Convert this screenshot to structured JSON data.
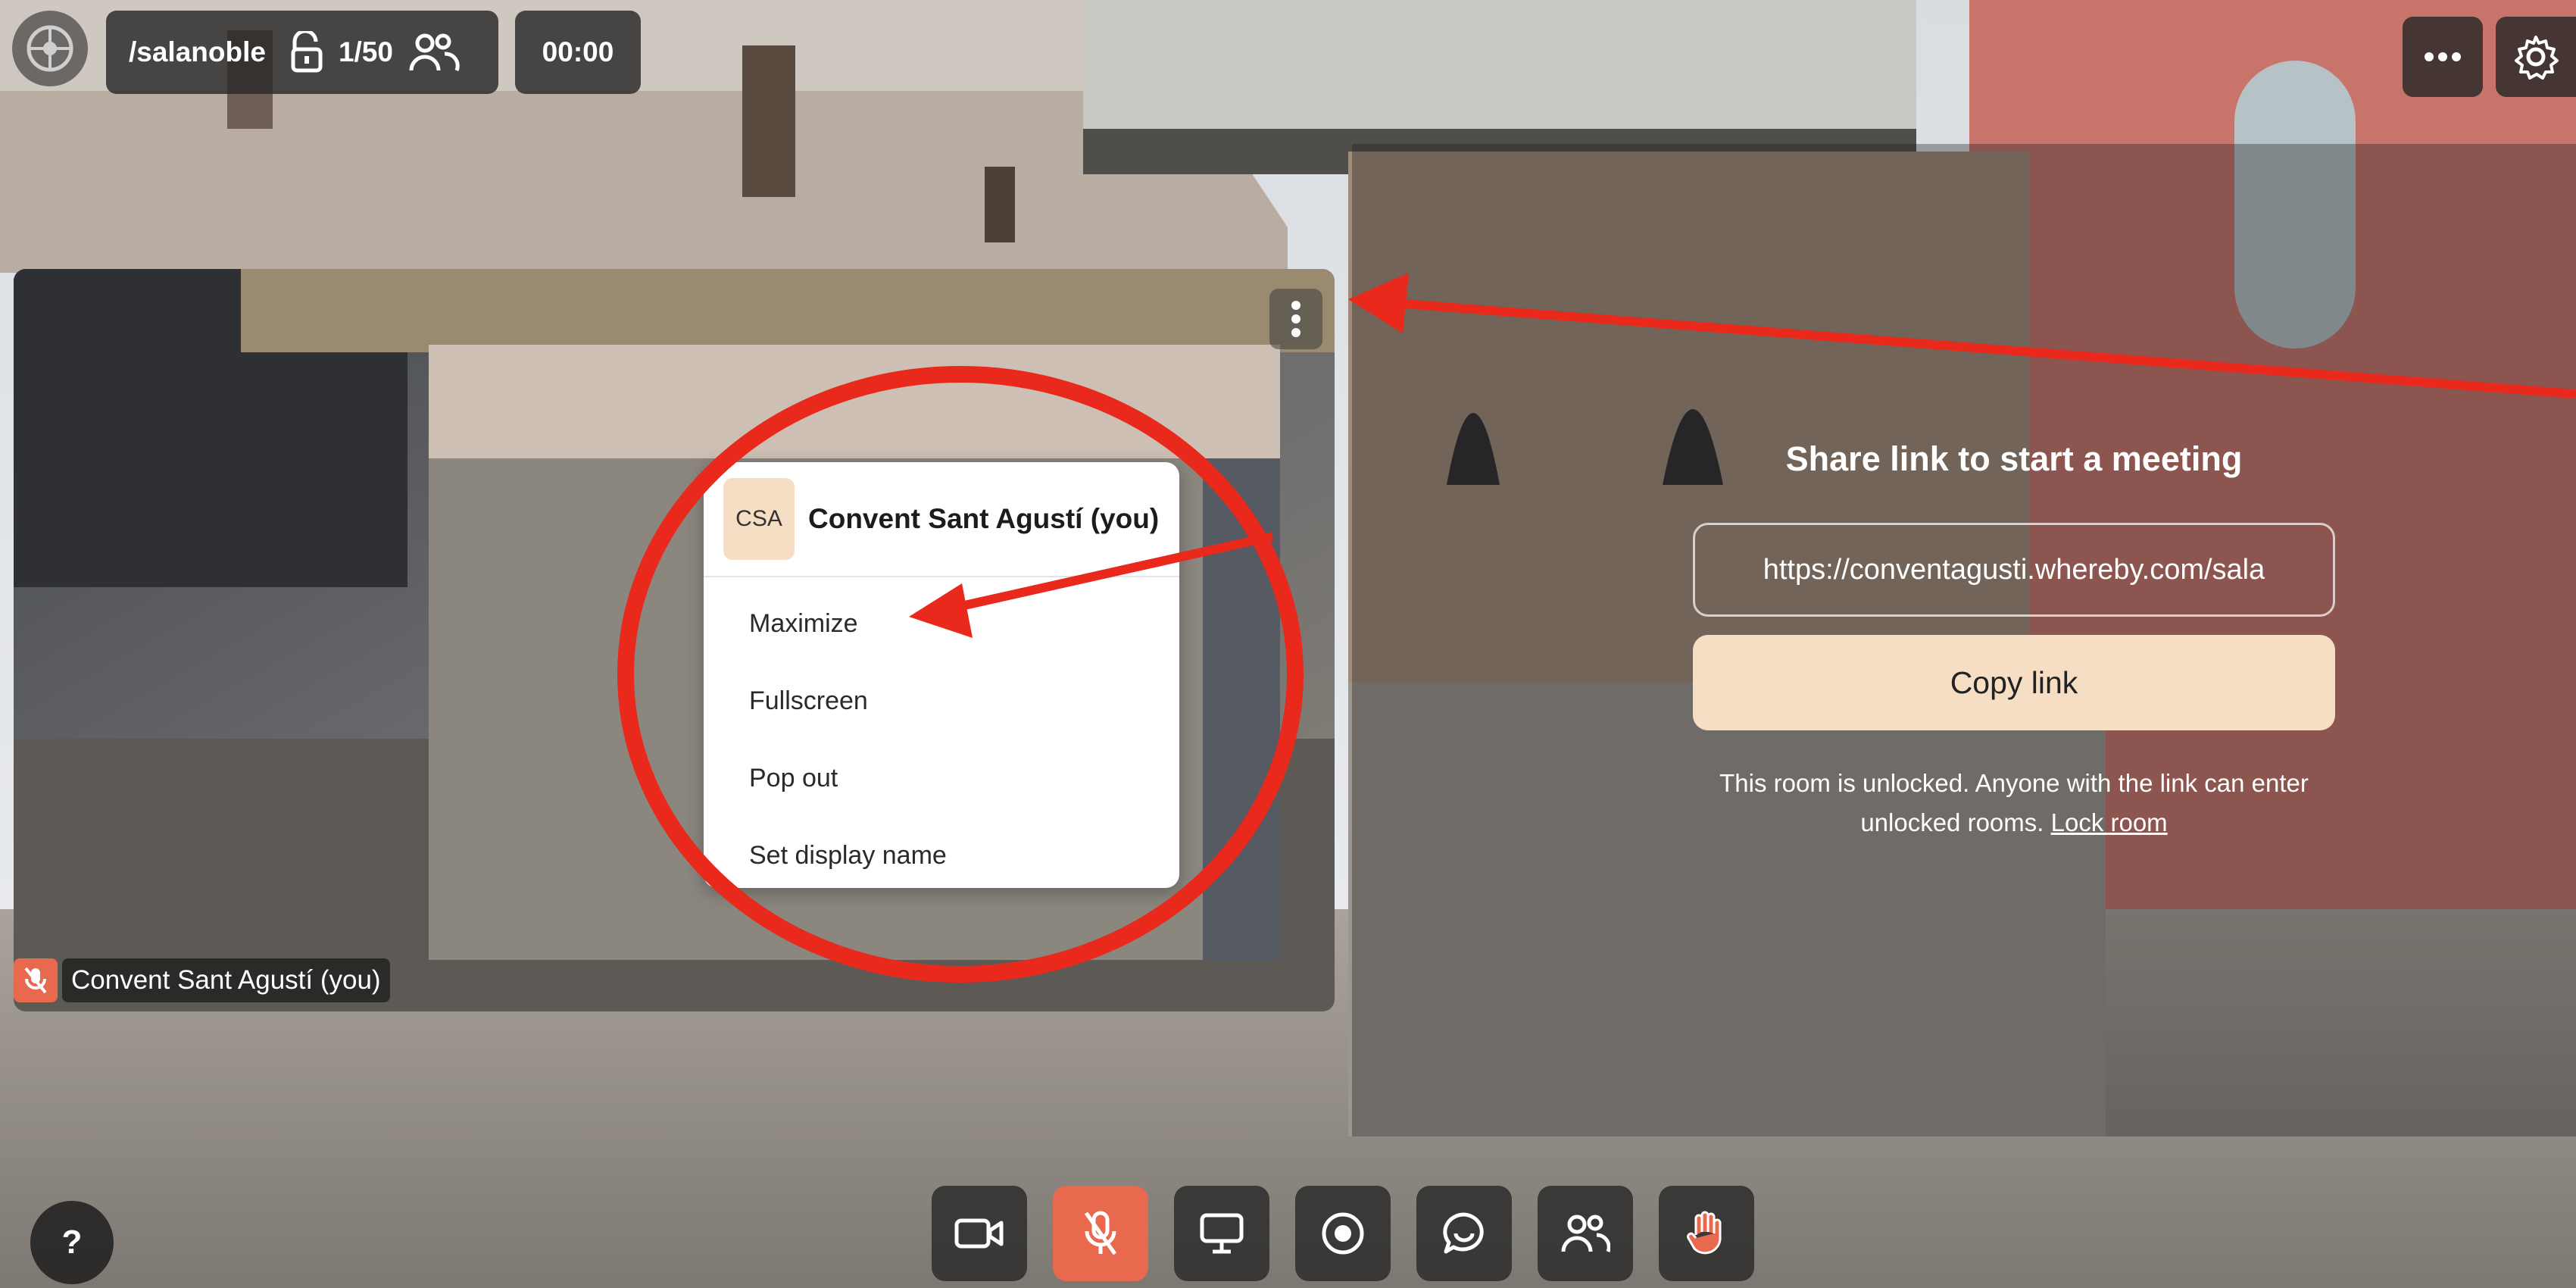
{
  "top_bar": {
    "room_name": "/salanoble",
    "participants": "1/50",
    "timer": "00:00"
  },
  "self_view": {
    "name_tag": "Convent Sant Agustí (you)"
  },
  "context_menu": {
    "avatar_initials": "CSA",
    "user_name": "Convent Sant Agustí (you)",
    "items": [
      {
        "label": "Maximize"
      },
      {
        "label": "Fullscreen"
      },
      {
        "label": "Pop out"
      },
      {
        "label": "Set display name"
      }
    ]
  },
  "share_panel": {
    "title": "Share link to start a meeting",
    "link_value": "https://conventagusti.whereby.com/sala",
    "copy_button": "Copy link",
    "info_text": "This room is unlocked. Anyone with the link can enter unlocked rooms.",
    "lock_link": "Lock room"
  },
  "help_button": "?",
  "colors": {
    "accent": "#e9694f",
    "annotation_red": "#e8291c",
    "copy_button_bg": "#f5dec3",
    "avatar_bg": "#f5dec3"
  },
  "icons": {
    "room_logo": "emblem-icon",
    "lock_state": "unlock-icon",
    "people": "people-icon",
    "more": "more-dots-icon",
    "settings": "gear-icon",
    "tile_menu": "kebab-icon",
    "mic_state": "mic-muted-icon",
    "toolbar": [
      "camera-icon",
      "mic-muted-icon",
      "screen-share-icon",
      "record-icon",
      "chat-icon",
      "people-icon",
      "raise-hand-icon"
    ]
  }
}
